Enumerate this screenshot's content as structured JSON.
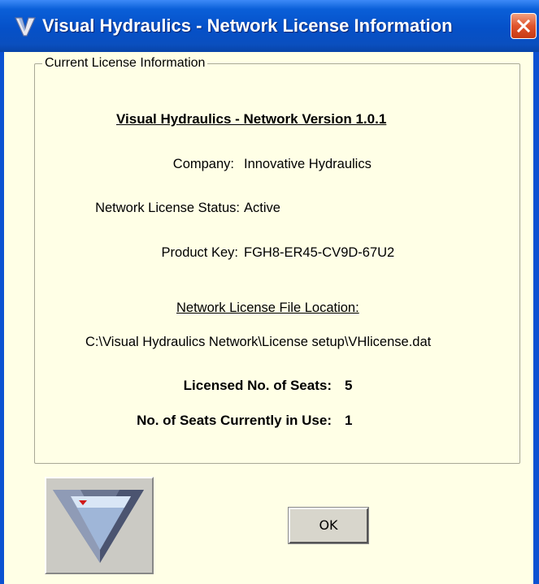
{
  "window": {
    "title": "Visual Hydraulics - Network License Information",
    "title_icon": "visual-hydraulics-v-logo-icon",
    "close_icon": "close-x-icon"
  },
  "license": {
    "group_title": "Current License Information",
    "heading": "Visual Hydraulics - Network Version 1.0.1",
    "company_label": "Company:",
    "company_value": "Innovative Hydraulics",
    "status_label": "Network License Status:",
    "status_value": "Active",
    "key_label": "Product Key:",
    "key_value": "FGH8-ER45-CV9D-67U2",
    "file_location_label": "Network License File Location:",
    "file_location_value": "C:\\Visual Hydraulics Network\\License setup\\VHlicense.dat",
    "seats_label": "Licensed No. of Seats:",
    "seats_value": "5",
    "in_use_label": "No. of Seats Currently in Use:",
    "in_use_value": "1"
  },
  "footer": {
    "logo_icon": "visual-hydraulics-logo-icon",
    "ok_label": "OK"
  },
  "colors": {
    "titlebar": "#0550c8",
    "dialog_background": "#ffffe6",
    "close_button": "#e0542c"
  }
}
